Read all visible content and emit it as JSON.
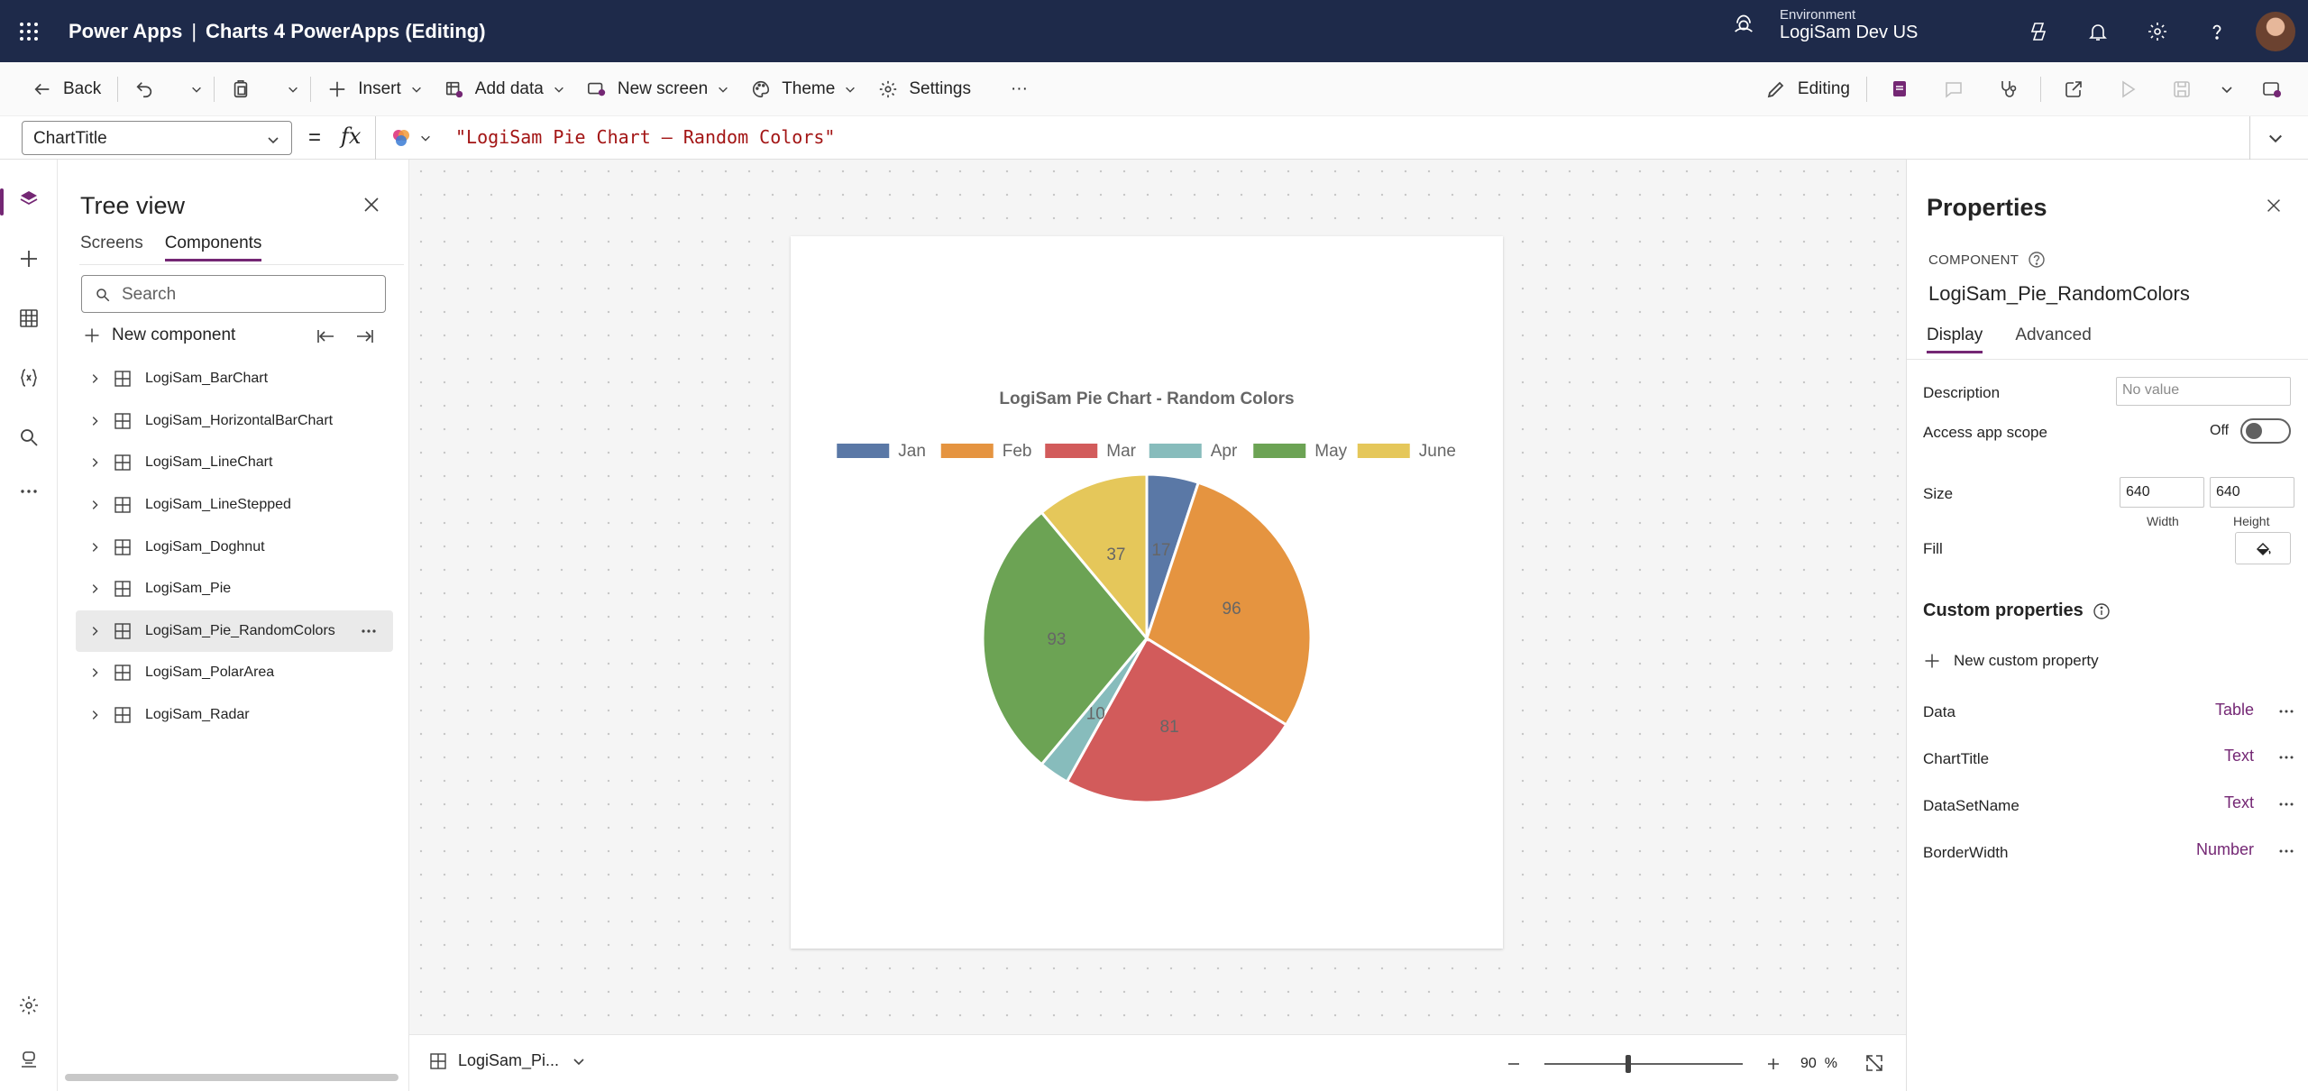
{
  "app": {
    "product": "Power Apps",
    "title": "Charts 4 PowerApps (Editing)"
  },
  "environment": {
    "label": "Environment",
    "value": "LogiSam Dev US"
  },
  "topbar_icons": [
    "copilot-icon",
    "bell-icon",
    "gear-icon",
    "help-icon",
    "avatar"
  ],
  "toolbar": {
    "back": "Back",
    "insert": "Insert",
    "add_data": "Add data",
    "new_screen": "New screen",
    "theme": "Theme",
    "settings": "Settings",
    "more": "···",
    "editing": "Editing"
  },
  "formula": {
    "property": "ChartTitle",
    "equals": "=",
    "fx": "fx",
    "value": "\"LogiSam Pie Chart – Random Colors\""
  },
  "tree": {
    "title": "Tree view",
    "tabs": [
      "Screens",
      "Components"
    ],
    "active_tab": "Components",
    "search_placeholder": "Search",
    "new_component": "New component",
    "items": [
      {
        "label": "LogiSam_BarChart"
      },
      {
        "label": "LogiSam_HorizontalBarChart"
      },
      {
        "label": "LogiSam_LineChart"
      },
      {
        "label": "LogiSam_LineStepped"
      },
      {
        "label": "LogiSam_Doghnut"
      },
      {
        "label": "LogiSam_Pie"
      },
      {
        "label": "LogiSam_Pie_RandomColors",
        "selected": true
      },
      {
        "label": "LogiSam_PolarArea"
      },
      {
        "label": "LogiSam_Radar"
      }
    ]
  },
  "chart_data": {
    "type": "pie",
    "title": "LogiSam Pie Chart - Random Colors",
    "legend_position": "top",
    "categories": [
      "Jan",
      "Feb",
      "Mar",
      "Apr",
      "May",
      "June"
    ],
    "values": [
      17,
      96,
      81,
      10,
      93,
      37
    ],
    "data_labels": [
      "17",
      "96",
      "81",
      "10",
      "93",
      "37"
    ],
    "colors": [
      "#5a78a6",
      "#e59440",
      "#d25b5b",
      "#87bcbc",
      "#6ca354",
      "#e5c75a"
    ]
  },
  "status": {
    "screen": "LogiSam_Pi...",
    "zoom_value": 90,
    "zoom_pct": "90",
    "pct_sign": "%"
  },
  "props": {
    "title": "Properties",
    "type_label": "COMPONENT",
    "name": "LogiSam_Pie_RandomColors",
    "tabs": [
      "Display",
      "Advanced"
    ],
    "description_label": "Description",
    "description_placeholder": "No value",
    "scope_label": "Access app scope",
    "scope_value": "Off",
    "size_label": "Size",
    "width": "640",
    "height": "640",
    "width_caption": "Width",
    "height_caption": "Height",
    "fill_label": "Fill",
    "custom_title": "Custom properties",
    "new_custom": "New custom property",
    "custom": [
      {
        "name": "Data",
        "type": "Table"
      },
      {
        "name": "ChartTitle",
        "type": "Text"
      },
      {
        "name": "DataSetName",
        "type": "Text"
      },
      {
        "name": "BorderWidth",
        "type": "Number"
      }
    ]
  }
}
